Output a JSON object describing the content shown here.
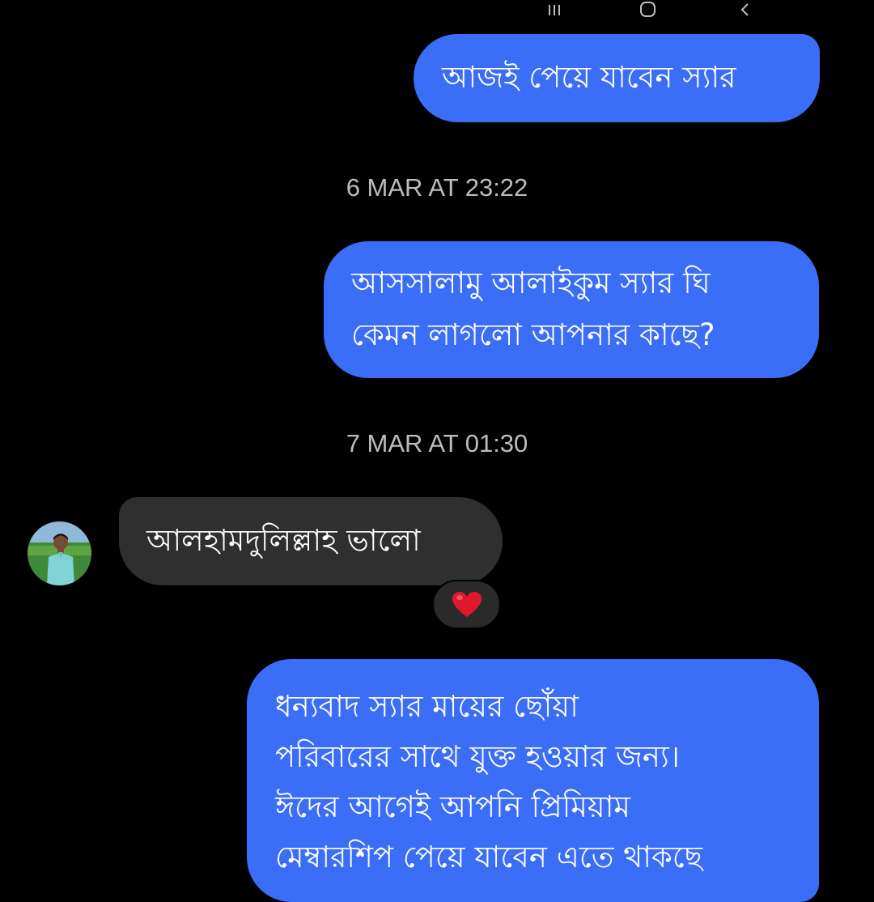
{
  "system_nav": {
    "recents_icon": "recents-icon",
    "home_icon": "home-icon",
    "back_icon": "back-icon"
  },
  "messages": [
    {
      "sender": "me",
      "text": "আজই পেয়ে যাবেন স্যার"
    },
    {
      "sender": "me",
      "lines": [
        "আসসালামু আলাইকুম স্যার ঘি",
        "কেমন লাগলো আপনার কাছে?"
      ]
    },
    {
      "sender": "contact",
      "text": "আলহামদুলিল্লাহ ভালো",
      "reaction": "❤️"
    },
    {
      "sender": "me",
      "lines": [
        "ধন্যবাদ স্যার মায়ের ছোঁয়া",
        "পরিবারের সাথে যুক্ত হওয়ার জন্য।",
        "ঈদের আগেই আপনি প্রিমিয়াম",
        "মেম্বারশিপ পেয়ে যাবেন এতে থাকছে"
      ]
    }
  ],
  "timestamps": [
    "6 MAR AT 23:22",
    "7 MAR AT 01:30"
  ],
  "colors": {
    "background": "#000000",
    "sent_bubble": "#3b6ef6",
    "received_bubble": "#2f2f2f",
    "timestamp_text": "#bdbdbd",
    "reaction_heart": "#e0182d"
  }
}
